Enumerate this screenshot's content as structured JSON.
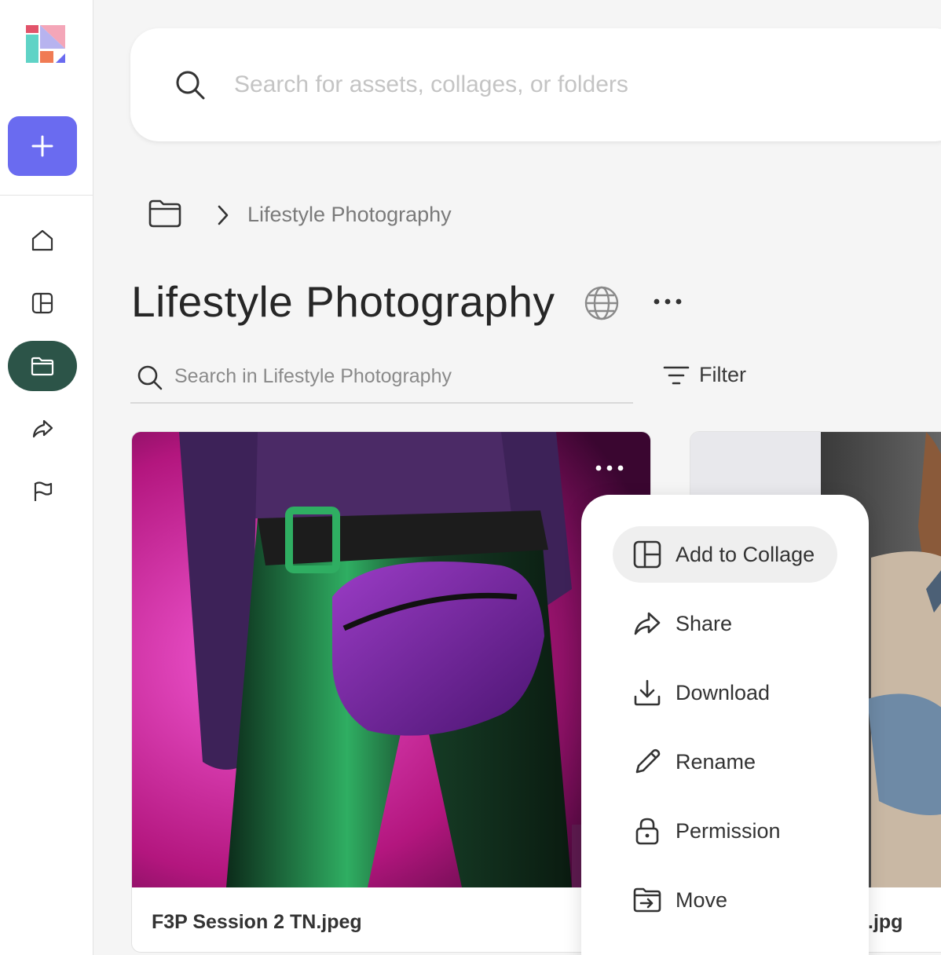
{
  "search": {
    "placeholder": "Search for assets, collages, or folders"
  },
  "breadcrumb": {
    "current": "Lifestyle Photography"
  },
  "page": {
    "title": "Lifestyle Photography"
  },
  "folder_search": {
    "placeholder": "Search in Lifestyle Photography"
  },
  "filter": {
    "label": "Filter"
  },
  "cards": [
    {
      "filename": "F3P Session 2 TN.jpeg"
    },
    {
      "filename": ".jpg"
    }
  ],
  "menu": {
    "items": [
      {
        "label": "Add to Collage",
        "icon": "collage-icon"
      },
      {
        "label": "Share",
        "icon": "share-icon"
      },
      {
        "label": "Download",
        "icon": "download-icon"
      },
      {
        "label": "Rename",
        "icon": "pencil-icon"
      },
      {
        "label": "Permission",
        "icon": "lock-icon"
      },
      {
        "label": "Move",
        "icon": "move-folder-icon"
      }
    ]
  },
  "colors": {
    "accent": "#6a6bf0",
    "active_nav": "#2c5448"
  }
}
